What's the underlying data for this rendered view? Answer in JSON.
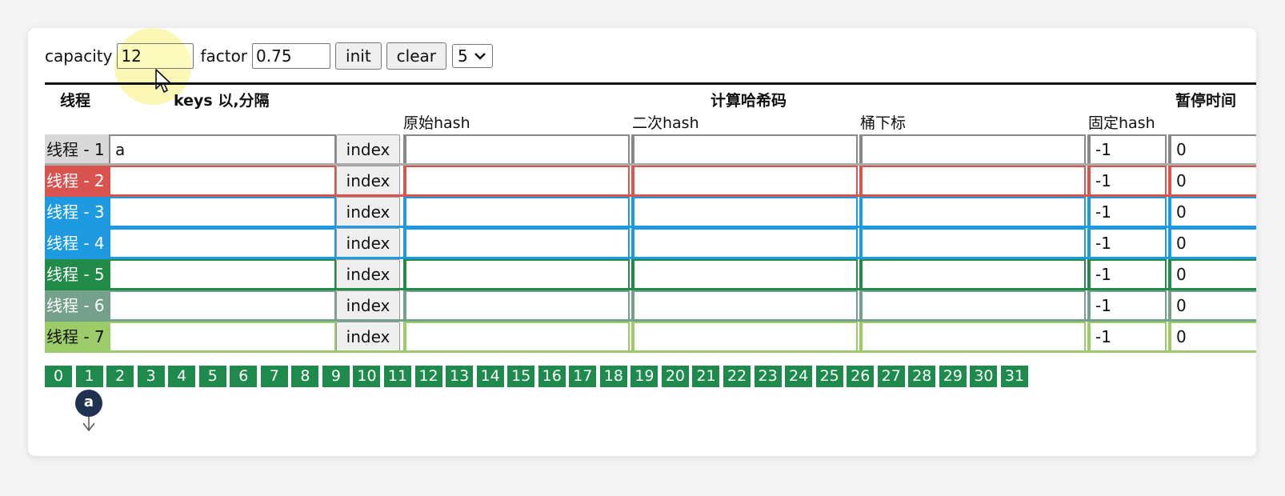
{
  "toolbar": {
    "capacity_label": "capacity",
    "capacity_value": "12",
    "factor_label": "factor",
    "factor_value": "0.75",
    "init_label": "init",
    "clear_label": "clear",
    "select_value": "5"
  },
  "header": {
    "thread": "线程",
    "keys": "keys 以,分隔",
    "compute": "计算哈希码",
    "pause": "暂停时间",
    "raw_hash": "原始hash",
    "second_hash": "二次hash",
    "bucket_index": "桶下标",
    "fixed_hash": "固定hash"
  },
  "rows": [
    {
      "label": "线程 - 1",
      "key": "a",
      "index_label": "index",
      "raw": "",
      "second": "",
      "bucket": "",
      "fixed": "-1",
      "pause": "0",
      "color": "#d9d9d9",
      "text_color": "#111111"
    },
    {
      "label": "线程 - 2",
      "key": "",
      "index_label": "index",
      "raw": "",
      "second": "",
      "bucket": "",
      "fixed": "-1",
      "pause": "0",
      "color": "#d9534f",
      "text_color": "#ffffff"
    },
    {
      "label": "线程 - 3",
      "key": "",
      "index_label": "index",
      "raw": "",
      "second": "",
      "bucket": "",
      "fixed": "-1",
      "pause": "0",
      "color": "#1e9be0",
      "text_color": "#ffffff"
    },
    {
      "label": "线程 - 4",
      "key": "",
      "index_label": "index",
      "raw": "",
      "second": "",
      "bucket": "",
      "fixed": "-1",
      "pause": "0",
      "color": "#1e9be0",
      "text_color": "#ffffff"
    },
    {
      "label": "线程 - 5",
      "key": "",
      "index_label": "index",
      "raw": "",
      "second": "",
      "bucket": "",
      "fixed": "-1",
      "pause": "0",
      "color": "#228b4a",
      "text_color": "#ffffff"
    },
    {
      "label": "线程 - 6",
      "key": "",
      "index_label": "index",
      "raw": "",
      "second": "",
      "bucket": "",
      "fixed": "-1",
      "pause": "0",
      "color": "#74a08c",
      "text_color": "#ffffff"
    },
    {
      "label": "线程 - 7",
      "key": "",
      "index_label": "index",
      "raw": "",
      "second": "",
      "bucket": "",
      "fixed": "-1",
      "pause": "0",
      "color": "#9ccc6a",
      "text_color": "#111111"
    }
  ],
  "buckets": [
    "0",
    "1",
    "2",
    "3",
    "4",
    "5",
    "6",
    "7",
    "8",
    "9",
    "10",
    "11",
    "12",
    "13",
    "14",
    "15",
    "16",
    "17",
    "18",
    "19",
    "20",
    "21",
    "22",
    "23",
    "24",
    "25",
    "26",
    "27",
    "28",
    "29",
    "30",
    "31"
  ],
  "bucket_color": "#1e8a4c",
  "node": {
    "label": "a",
    "bucket": "1",
    "color": "#1f3350"
  }
}
